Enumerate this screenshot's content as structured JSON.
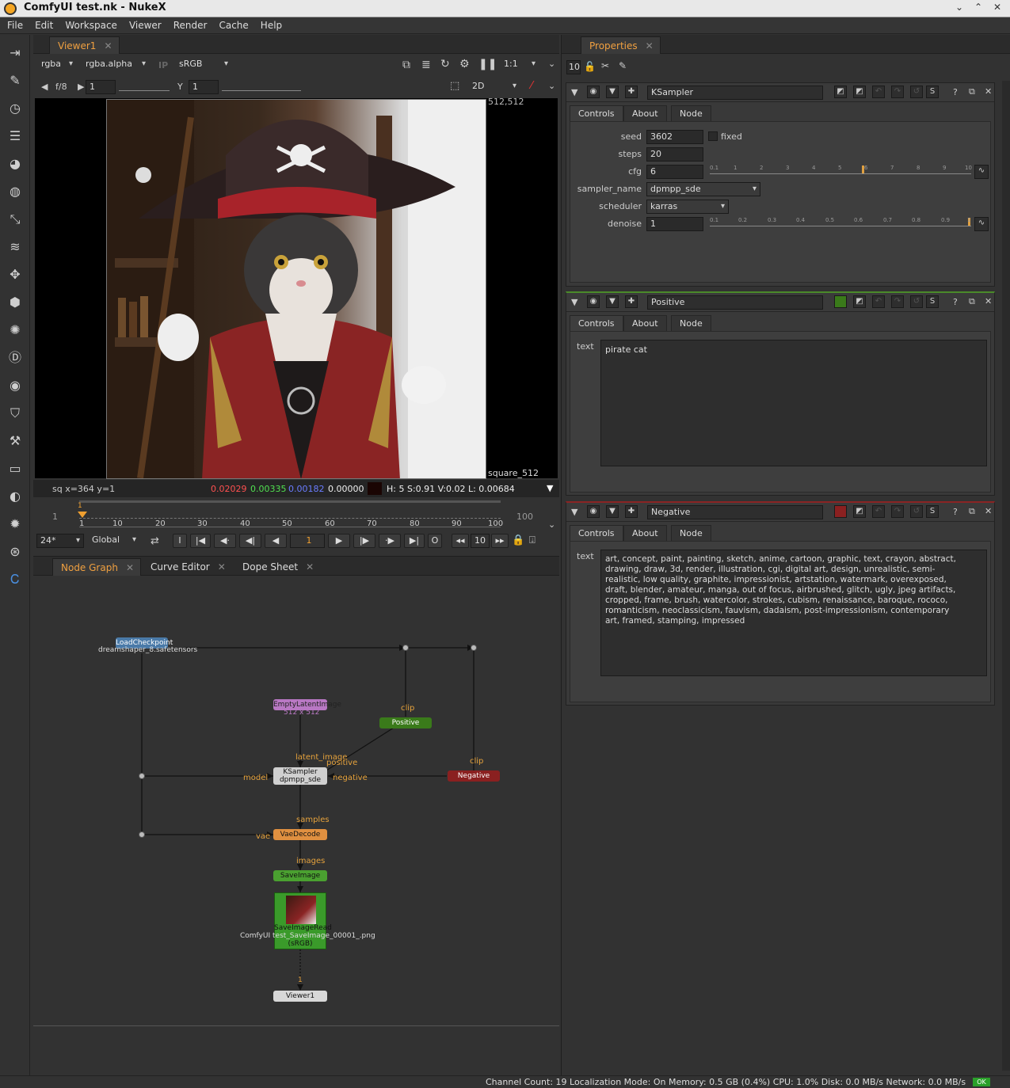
{
  "window": {
    "title": "ComfyUI test.nk - NukeX"
  },
  "menu": [
    "File",
    "Edit",
    "Workspace",
    "Viewer",
    "Render",
    "Cache",
    "Help"
  ],
  "viewer": {
    "tab": "Viewer1",
    "channels": "rgba",
    "alpha": "rgba.alpha",
    "ip": "IP",
    "colorspace": "sRGB",
    "zoom": "1:1",
    "fstop": "f/8",
    "gain": "1",
    "gamma_label": "Y",
    "gamma": "1",
    "mode": "2D",
    "corner": "512,512",
    "format": "square_512",
    "status": {
      "coord": "sq  x=364 y=1",
      "r": "0.02029",
      "g": "0.00335",
      "b": "0.00182",
      "a": "0.00000",
      "hsv": "H:  5 S:0.91 V:0.02  L: 0.00684"
    },
    "timeline": {
      "start": "1",
      "end": "100",
      "current": "1",
      "ticks": [
        "1",
        "10",
        "20",
        "30",
        "40",
        "50",
        "60",
        "70",
        "80",
        "90",
        "100"
      ]
    },
    "playback": {
      "fps": "24*",
      "scope": "Global",
      "frame": "1",
      "step": "10"
    }
  },
  "graph_tabs": [
    "Node Graph",
    "Curve Editor",
    "Dope Sheet"
  ],
  "nodes": {
    "load": [
      "LoadCheckpoint",
      "dreamshaper_8.safetensors"
    ],
    "empty": [
      "EmptyLatentImage",
      "512 x 512"
    ],
    "positive": "Positive",
    "ksampler": [
      "KSampler",
      "dpmpp_sde"
    ],
    "negative": "Negative",
    "vae": "VaeDecode",
    "save": "SaveImage",
    "read": [
      "SaveImageRead",
      "ComfyUI test_SaveImage_00001_.png",
      "(sRGB)"
    ],
    "viewer": "Viewer1"
  },
  "pins": {
    "clip1": "clip",
    "clip2": "clip",
    "latent": "latent_image",
    "positive": "positive",
    "model": "model",
    "negative": "negative",
    "samples": "samples",
    "vae": "vae",
    "images": "images",
    "v1": "1"
  },
  "properties": {
    "tab": "Properties",
    "count": "10",
    "subtabs": [
      "Controls",
      "About",
      "Node"
    ],
    "ksampler": {
      "name": "KSampler",
      "seed_label": "seed",
      "seed": "3602",
      "fixed": "fixed",
      "steps_label": "steps",
      "steps": "20",
      "cfg_label": "cfg",
      "cfg": "6",
      "sampler_label": "sampler_name",
      "sampler": "dpmpp_sde",
      "sched_label": "scheduler",
      "scheduler": "karras",
      "denoise_label": "denoise",
      "denoise": "1",
      "cfg_ticks": [
        "0.1",
        "1",
        "2",
        "3",
        "4",
        "5",
        "6",
        "7",
        "8",
        "9",
        "10"
      ],
      "denoise_ticks": [
        "0.1",
        "0.2",
        "0.3",
        "0.4",
        "0.5",
        "0.6",
        "0.7",
        "0.8",
        "0.9",
        "1"
      ]
    },
    "positive": {
      "name": "Positive",
      "text_label": "text",
      "text": "pirate cat"
    },
    "negative": {
      "name": "Negative",
      "text_label": "text",
      "text": "art, concept, paint, painting, sketch, anime, cartoon, graphic, text, crayon, abstract,\ndrawing, draw, 3d, render, illustration, cgi, digital art, design, unrealistic, semi-\nrealistic, low quality, graphite, impressionist, artstation, watermark, overexposed,\ndraft, blender, amateur, manga, out of focus, airbrushed, glitch, ugly, jpeg artifacts,\ncropped, frame, brush, watercolor, strokes, cubism, renaissance, baroque, rococo,\nromanticism, neoclassicism, fauvism, dadaism, post-impressionism, contemporary\nart, framed, stamping, impressed"
    }
  },
  "statusbar": "Channel Count: 19  Localization Mode: On  Memory: 0.5 GB (0.4%) CPU: 1.0% Disk: 0.0 MB/s Network: 0.0 MB/s",
  "ok": "OK"
}
